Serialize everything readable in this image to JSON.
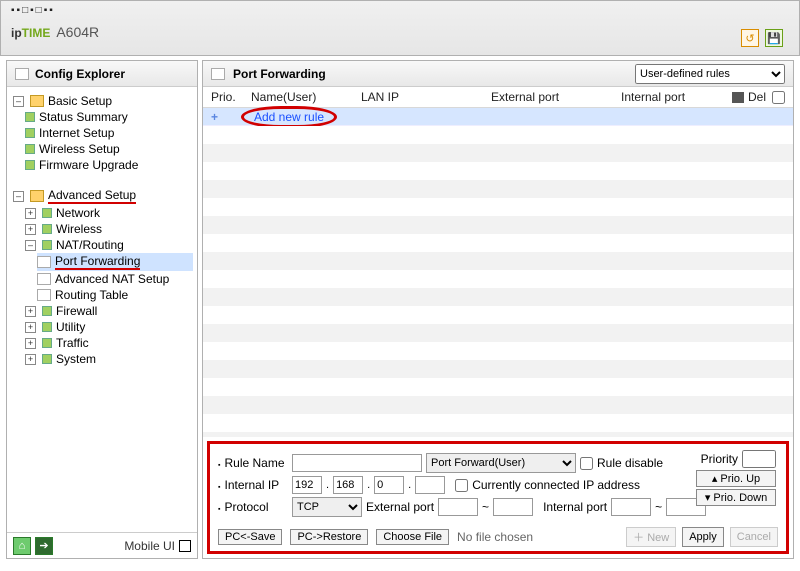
{
  "logo": {
    "pre": "▪▪□▪□▪▪",
    "ip": "ip",
    "time": "TIME",
    "model": "A604R"
  },
  "tree": {
    "header": "Config Explorer",
    "basic": {
      "title": "Basic Setup",
      "items": [
        "Status Summary",
        "Internet Setup",
        "Wireless Setup",
        "Firmware Upgrade"
      ]
    },
    "advanced": {
      "title": "Advanced Setup",
      "network": "Network",
      "wireless": "Wireless",
      "nat": {
        "title": "NAT/Routing",
        "pf": "Port Forwarding",
        "anat": "Advanced NAT Setup",
        "rt": "Routing Table"
      },
      "firewall": "Firewall",
      "utility": "Utility",
      "traffic": "Traffic",
      "system": "System"
    },
    "footer": "Mobile UI"
  },
  "panel": {
    "title": "Port Forwarding",
    "dropdown": "User-defined rules",
    "cols": {
      "prio": "Prio.",
      "name": "Name(User)",
      "lan": "LAN IP",
      "ext": "External port",
      "int": "Internal port",
      "del": "Del"
    },
    "addnew": "Add new rule"
  },
  "form": {
    "rulename_label": "Rule Name",
    "rule_type": "Port Forward(User)",
    "rule_disable": "Rule disable",
    "internalip_label": "Internal IP",
    "ip1": "192",
    "ip2": "168",
    "ip3": "0",
    "ip4": "",
    "conn_ip": "Currently connected IP address",
    "protocol_label": "Protocol",
    "protocol": "TCP",
    "extport_label": "External port",
    "intport_label": "Internal port",
    "tilde": "~",
    "priority_label": "Priority",
    "prio_up": "▴ Prio. Up",
    "prio_down": "▾ Prio. Down",
    "pcsave": "PC<-Save",
    "pcrestore": "PC->Restore",
    "choose": "Choose File",
    "nofile": "No file chosen",
    "new": "＋ New",
    "apply": "Apply",
    "cancel": "Cancel"
  }
}
